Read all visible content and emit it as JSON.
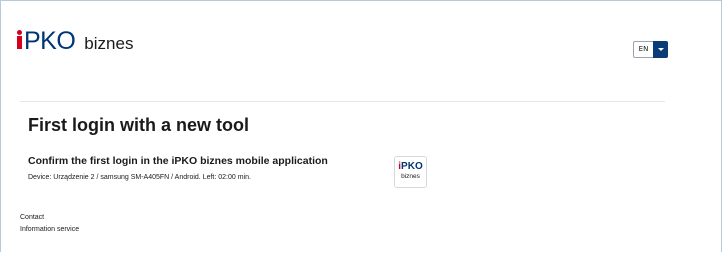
{
  "header": {
    "logo_mark": "PKO",
    "logo_suffix": "biznes",
    "language": {
      "selected": "EN"
    }
  },
  "main": {
    "title": "First login with a new tool",
    "confirm_heading": "Confirm the first login in the iPKO biznes mobile application",
    "device_info": "Device: Urządzenie 2 / samsung SM-A405FN / Android. Left: 02:00 min.",
    "app_icon": {
      "line1": "PKO",
      "line2": "biznes"
    }
  },
  "footer": {
    "links": [
      "Contact",
      "Information service"
    ]
  },
  "colors": {
    "brand_navy": "#003574",
    "brand_red": "#d6001c",
    "dropdown_button": "#0c3c78"
  },
  "icons": {
    "lang_caret": "caret-down-icon"
  }
}
